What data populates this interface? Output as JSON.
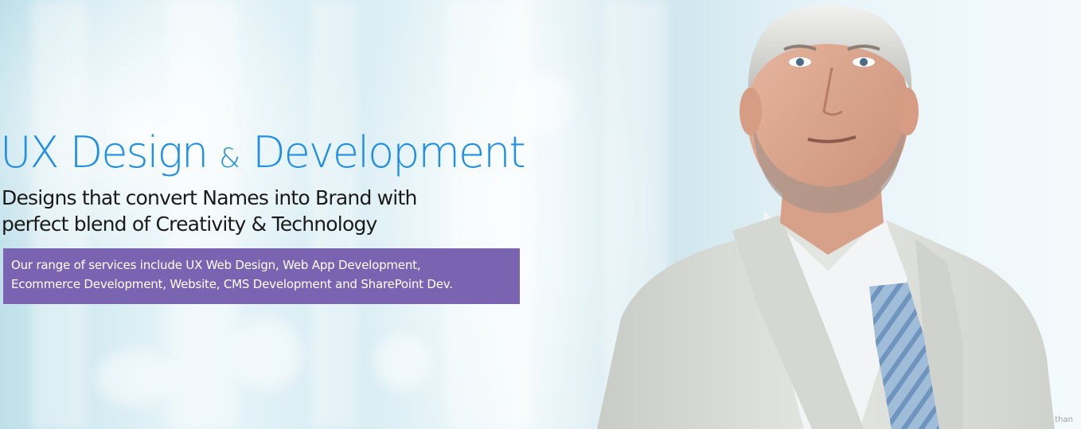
{
  "hero": {
    "headline_part1": "UX Design ",
    "headline_amp": "&",
    "headline_part2": " Development",
    "subhead_line1": "Designs that convert Names into Brand with",
    "subhead_line2": "perfect blend of Creativity & Technology",
    "services_line1": "Our range of services include UX Web Design, Web App Development,",
    "services_line2": "Ecommerce Development, Website, CMS Development and SharePoint Dev.",
    "watermark": "than"
  },
  "colors": {
    "headline": "#1f8fe6",
    "services_box": "#7a64b1",
    "suit": "#d9dcd6",
    "tie": "#8fb0cf"
  },
  "icons": {
    "portrait": "businessman-photo"
  }
}
